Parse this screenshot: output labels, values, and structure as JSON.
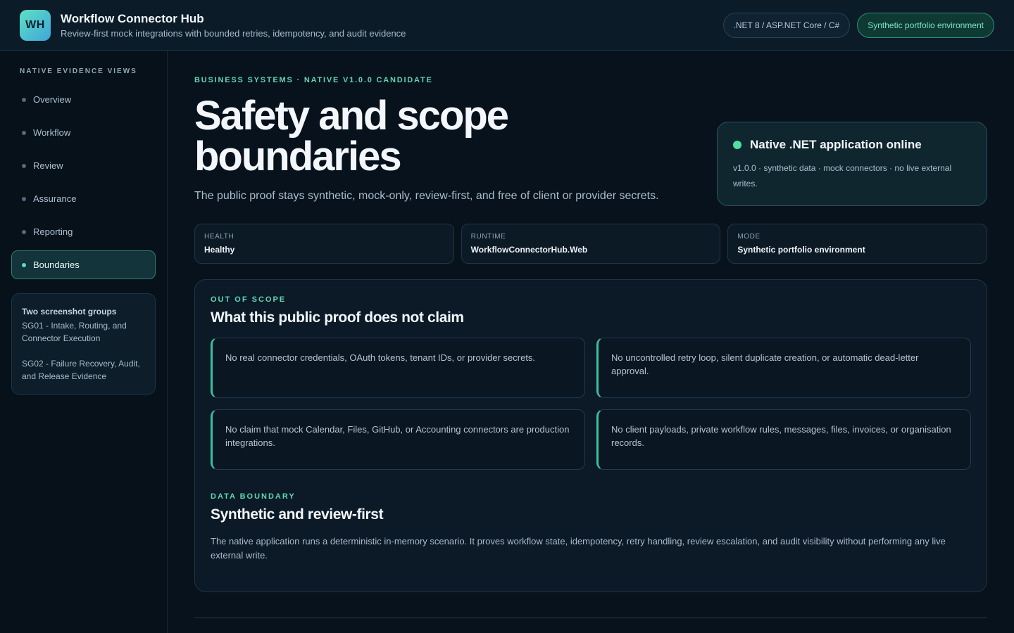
{
  "header": {
    "logo": "WH",
    "title": "Workflow Connector Hub",
    "subtitle": "Review-first mock integrations with bounded retries, idempotency, and audit evidence",
    "pills": [
      ".NET 8 / ASP.NET Core / C#",
      "Synthetic portfolio environment"
    ]
  },
  "sidebar": {
    "heading": "NATIVE EVIDENCE VIEWS",
    "items": [
      {
        "label": "Overview"
      },
      {
        "label": "Workflow"
      },
      {
        "label": "Review"
      },
      {
        "label": "Assurance"
      },
      {
        "label": "Reporting"
      },
      {
        "label": "Boundaries"
      }
    ],
    "active": "Boundaries",
    "groups": {
      "title": "Two screenshot groups",
      "sg01": "SG01 - Intake, Routing, and Connector Execution",
      "sg02": "SG02 - Failure Recovery, Audit, and Release Evidence"
    }
  },
  "main": {
    "eyebrow": "BUSINESS SYSTEMS · NATIVE V1.0.0 CANDIDATE",
    "title": "Safety and scope boundaries",
    "lede": "The public proof stays synthetic, mock-only, review-first, and free of client or provider secrets.",
    "status": {
      "title": "Native .NET application online",
      "desc": "v1.0.0 · synthetic data · mock connectors · no live external writes.",
      "color": "#4fe0a3"
    },
    "meta": [
      {
        "label": "HEALTH",
        "value": "Healthy"
      },
      {
        "label": "RUNTIME",
        "value": "WorkflowConnectorHub.Web"
      },
      {
        "label": "MODE",
        "value": "Synthetic portfolio environment"
      }
    ],
    "out_of_scope": {
      "eyebrow": "OUT OF SCOPE",
      "title": "What this public proof does not claim",
      "claims": [
        "No real connector credentials, OAuth tokens, tenant IDs, or provider secrets.",
        "No uncontrolled retry loop, silent duplicate creation, or automatic dead-letter approval.",
        "No claim that mock Calendar, Files, GitHub, or Accounting connectors are production integrations.",
        "No client payloads, private workflow rules, messages, files, invoices, or organisation records."
      ]
    },
    "data_boundary": {
      "eyebrow": "DATA BOUNDARY",
      "title": "Synthetic and review-first",
      "text": "The native application runs a deterministic in-memory scenario. It proves workflow state, idempotency, retry handling, review escalation, and audit visibility without performing any live external write."
    }
  },
  "colors": {
    "accent": "#5fd6b3",
    "background": "#07121c"
  }
}
